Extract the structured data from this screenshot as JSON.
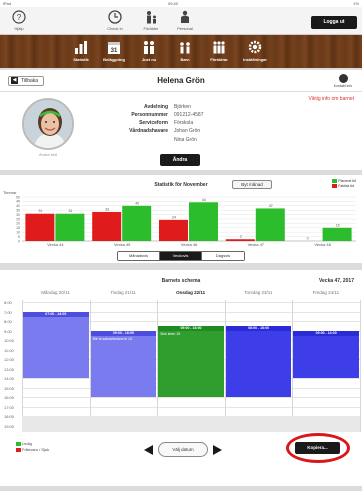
{
  "status_bar": {
    "carrier": "iPad",
    "time": "09:40",
    "battery": "1%"
  },
  "top_nav": {
    "items": [
      {
        "label": "Hjälp",
        "icon": "question-icon"
      },
      {
        "label": "Check in",
        "icon": "clock-icon"
      },
      {
        "label": "Förälder",
        "icon": "parent-icon"
      },
      {
        "label": "Personal",
        "icon": "staff-icon"
      }
    ],
    "logout_label": "Logga ut"
  },
  "wood_nav": {
    "items": [
      {
        "label": "Statistik",
        "icon": "chart-icon"
      },
      {
        "label": "Beläggning",
        "icon": "calendar-icon"
      },
      {
        "label": "Just nu",
        "icon": "people-icon"
      },
      {
        "label": "Barn",
        "icon": "child-icon"
      },
      {
        "label": "Föräldrar",
        "icon": "parents-icon"
      },
      {
        "label": "Inställningar",
        "icon": "gear-icon"
      }
    ]
  },
  "header": {
    "back_label": "Tillbaka",
    "title": "Helena Grön",
    "contact_label": "Kontakt info"
  },
  "profile": {
    "avatar_caption": "Ändra bild",
    "important_link": "Viktig info om barnet",
    "fields": [
      {
        "label": "Avdelning",
        "value": "Björken"
      },
      {
        "label": "Personnummer",
        "value": "091212-4587"
      },
      {
        "label": "Serviceform",
        "value": "Förskola"
      },
      {
        "label": "Vårdnadshavare",
        "value": "Johan Grön"
      },
      {
        "label": "",
        "value": "Nina Grön"
      }
    ],
    "change_label": "Ändra"
  },
  "statistics": {
    "title": "Statistik för November",
    "swap_label": "Byt månad",
    "legend": [
      {
        "label": "Planerat tid",
        "color": "#2bbd2b"
      },
      {
        "label": "Faktisk tid",
        "color": "#e01b1b"
      }
    ],
    "segments": [
      {
        "label": "Månadsvis",
        "active": false
      },
      {
        "label": "Veckovis",
        "active": true
      },
      {
        "label": "Dagsvis",
        "active": false
      }
    ]
  },
  "chart_data": {
    "type": "bar",
    "ylabel": "Timmar",
    "ylim": [
      0,
      50
    ],
    "yticks": [
      0,
      5,
      10,
      15,
      20,
      25,
      30,
      35,
      40,
      45,
      50
    ],
    "categories": [
      "Vecka 44",
      "Vecka 45",
      "Vecka 46",
      "Vecka 47",
      "Vecka 48"
    ],
    "series": [
      {
        "name": "Faktisk tid",
        "color": "#e01b1b",
        "values": [
          31,
          33,
          24,
          2,
          0
        ]
      },
      {
        "name": "Planerat tid",
        "color": "#2bbd2b",
        "values": [
          31,
          40,
          44,
          37,
          15
        ]
      }
    ],
    "grid": true
  },
  "schedule": {
    "title": "Barnets schema",
    "week_label": "Vecka 47, 2017",
    "days": [
      {
        "label": "Måndag 20/11",
        "selected": false
      },
      {
        "label": "Tisdag 21/11",
        "selected": false
      },
      {
        "label": "Onsdag 22/11",
        "selected": true
      },
      {
        "label": "Torsdag 23/11",
        "selected": false
      },
      {
        "label": "Fredag 24/11",
        "selected": false
      }
    ],
    "hours": [
      "6:00",
      "7:00",
      "8:00",
      "9:00",
      "10:00",
      "11:00",
      "12:00",
      "13:00",
      "14:00",
      "15:00",
      "16:00",
      "17:00",
      "18:00",
      "19:00"
    ],
    "blocks": [
      {
        "day": 0,
        "start_hour": 7.0,
        "end_hour": 14.0,
        "time": "07:00 - 14:00",
        "note": "",
        "style": "light"
      },
      {
        "day": 1,
        "start_hour": 9.0,
        "end_hour": 16.0,
        "time": "09:00 - 16:00",
        "note": "Blir ta saknahedone kl 13",
        "style": "light"
      },
      {
        "day": 2,
        "start_hour": 8.5,
        "end_hour": 16.0,
        "time": "09:00 - 16:00",
        "note": "Sick keen 15",
        "style": "green"
      },
      {
        "day": 3,
        "start_hour": 8.5,
        "end_hour": 16.0,
        "time": "08:00 - 16:00",
        "note": "",
        "style": "dark"
      },
      {
        "day": 4,
        "start_hour": 9.0,
        "end_hour": 14.0,
        "time": "09:00 - 14:00",
        "note": "",
        "style": "dark"
      }
    ],
    "legend": [
      {
        "label": "Ledig",
        "color": "#2bbd2b"
      },
      {
        "label": "Frånvaro / Sjuk",
        "color": "#e01b1b"
      }
    ],
    "date_button_label": "Välj datum",
    "copy_button_label": "Kopiera..."
  },
  "colors": {
    "block_light": "#7b7bf0",
    "block_light_head": "#4d4de0",
    "block_dark": "#3e3ee8",
    "block_dark_head": "#2a2ad6",
    "block_green": "#2f9e2f",
    "block_green_head": "#1f8a1f",
    "highlight_ring": "#d8171b"
  }
}
